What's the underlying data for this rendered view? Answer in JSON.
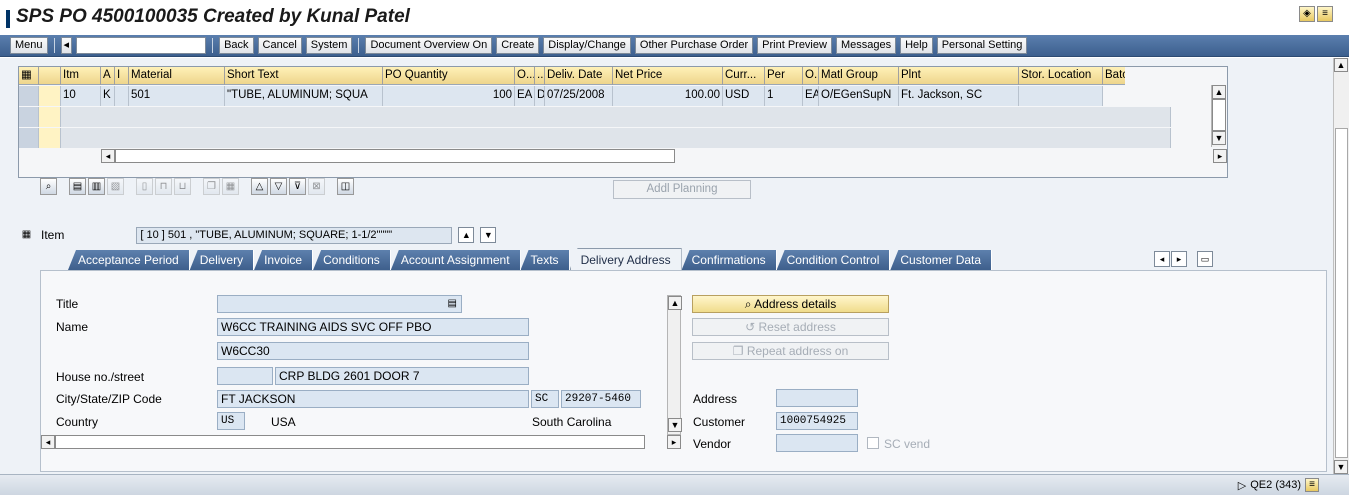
{
  "window": {
    "title": "SPS PO 4500100035 Created by Kunal Patel"
  },
  "toolbar": {
    "menu": "Menu",
    "command_value": "",
    "buttons": [
      "Back",
      "Cancel",
      "System",
      "Document Overview On",
      "Create",
      "Display/Change",
      "Other Purchase Order",
      "Print Preview",
      "Messages",
      "Help",
      "Personal Setting"
    ]
  },
  "grid": {
    "headers": [
      "",
      "",
      "Itm",
      "A",
      "I",
      "Material",
      "Short Text",
      "PO Quantity",
      "O...",
      "..",
      "Deliv. Date",
      "Net Price",
      "Curr...",
      "Per",
      "O...",
      "Matl Group",
      "Plnt",
      "Stor. Location",
      "Batch"
    ],
    "row": {
      "itm": "10",
      "a": "K",
      "i": "",
      "material": "501",
      "short_text": "\"TUBE, ALUMINUM; SQUA",
      "po_quantity": "100",
      "order_unit": "EA",
      "date_cat": "D",
      "deliv_date": "07/25/2008",
      "net_price": "100.00",
      "currency": "USD",
      "per": "1",
      "price_unit": "EA",
      "matl_group": "O/EGenSupN",
      "plant": "Ft. Jackson, SC",
      "stor_location": "",
      "batch": ""
    },
    "addl_planning": "Addl Planning"
  },
  "item": {
    "label": "Item",
    "selector_value": "[ 10 ] 501 , \"TUBE, ALUMINUM; SQUARE; 1-1/2\"\"\"\""
  },
  "tabs": [
    "Acceptance Period",
    "Delivery",
    "Invoice",
    "Conditions",
    "Account Assignment",
    "Texts",
    "Delivery Address",
    "Confirmations",
    "Condition Control",
    "Customer Data"
  ],
  "active_tab": "Delivery Address",
  "address": {
    "title_label": "Title",
    "title_value": "",
    "name_label": "Name",
    "name1": "W6CC TRAINING AIDS SVC OFF PBO",
    "name2": "W6CC30",
    "street_label": "House no./street",
    "house_no": "",
    "street": "CRP BLDG 2601 DOOR 7",
    "city_label": "City/State/ZIP Code",
    "city": "FT JACKSON",
    "state": "SC",
    "zip": "29207-5460",
    "country_label": "Country",
    "country_code": "US",
    "country_name": "USA",
    "region_name": "South Carolina"
  },
  "actions": {
    "address_details": "Address details",
    "reset_address": "Reset address",
    "repeat_address": "Repeat address on"
  },
  "side_fields": {
    "address_label": "Address",
    "address_value": "",
    "customer_label": "Customer",
    "customer_value": "1000754925",
    "vendor_label": "Vendor",
    "vendor_value": "",
    "sc_vend_label": "SC vend"
  },
  "status": {
    "system": "QE2 (343)"
  }
}
